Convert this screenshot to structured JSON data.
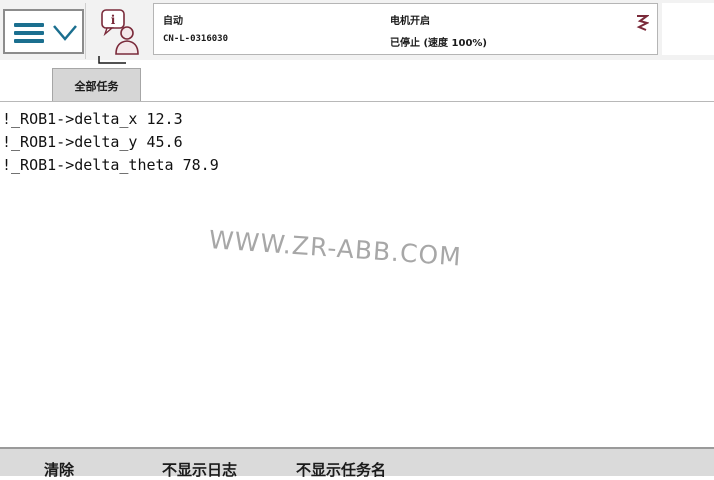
{
  "header": {
    "menu_icon": "hamburger-icon",
    "dropdown_icon": "chevron-down-icon",
    "tasks_icon": "task-info-user-icon",
    "status": {
      "mode": "自动",
      "controller_id": "CN-L-0316030",
      "motor_state": "电机开启",
      "program_state": "已停止 (速度 100%)"
    },
    "close_icon": "close-icon"
  },
  "tabs": [
    {
      "label": "全部任务"
    }
  ],
  "log": {
    "lines": [
      "!_ROB1->delta_x 12.3",
      "!_ROB1->delta_y 45.6",
      "!_ROB1->delta_theta 78.9"
    ]
  },
  "watermark": "WWW.ZR-ABB.COM",
  "footer": {
    "clear_label": "清除",
    "hide_log_label": "不显示日志",
    "hide_task_label": "不显示任务名"
  },
  "colors": {
    "accent": "#1b6f8f",
    "topbar_bg": "#f2f2f2",
    "footer_bg": "#dadada",
    "tab_bg": "#d6d6d6"
  }
}
